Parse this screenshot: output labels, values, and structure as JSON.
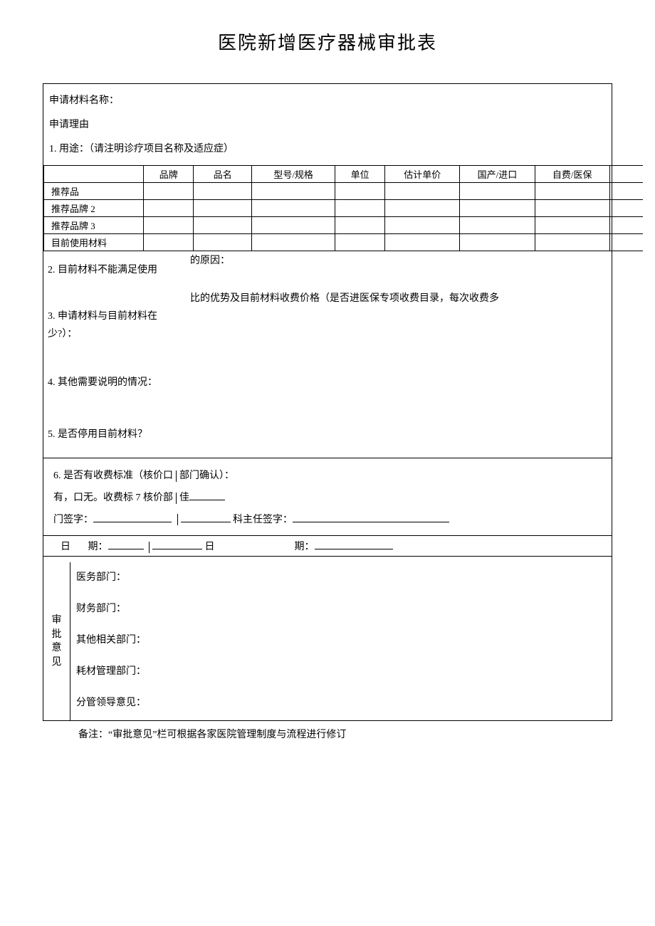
{
  "title": "医院新增医疗器械审批表",
  "header": {
    "material_name_label": "申请材料名称：",
    "reason_label": "申请理由",
    "usage_label": "1. 用途：（请注明诊疗项目名称及适应症）"
  },
  "grid": {
    "cols": [
      "",
      "品牌",
      "品名",
      "型号/规格",
      "单位",
      "估计单价",
      "国产/进口",
      "自费/医保"
    ],
    "rows": [
      {
        "label": "推荐品"
      },
      {
        "label": "推荐品牌 2"
      },
      {
        "label": "推荐品牌 3"
      },
      {
        "label": "目前使用材料"
      }
    ]
  },
  "sections": {
    "s2_left": "2. 目前材料不能满足使用",
    "s2_right": "的原因：",
    "s3_left": "3. 申请材料与目前材料在少?）：",
    "s3_right": "比的优势及目前材料收费价格（是否进医保专项收费目录，每次收费多",
    "s4": "4. 其他需要说明的情况：",
    "s5": "5. 是否停用目前材料？"
  },
  "block6": {
    "line1_a": "6. 是否有收费标准（核价口",
    "line1_b": "部门确认）：",
    "line2_a": "有，口无。收费标 7 核价部",
    "line2_b": "佳",
    "line3_a": "门签字：",
    "line3_b": "科主任签字：",
    "date1_a": "日",
    "date1_b": "期：",
    "date2_a": "日",
    "date2_b": "期："
  },
  "approval": {
    "side": "审批意见",
    "rows": [
      "医务部门：",
      "财务部门：",
      "其他相关部门：",
      "耗材管理部门：",
      "分管领导意见："
    ]
  },
  "note": "备注：“审批意见”栏可根据各家医院管理制度与流程进行修订"
}
